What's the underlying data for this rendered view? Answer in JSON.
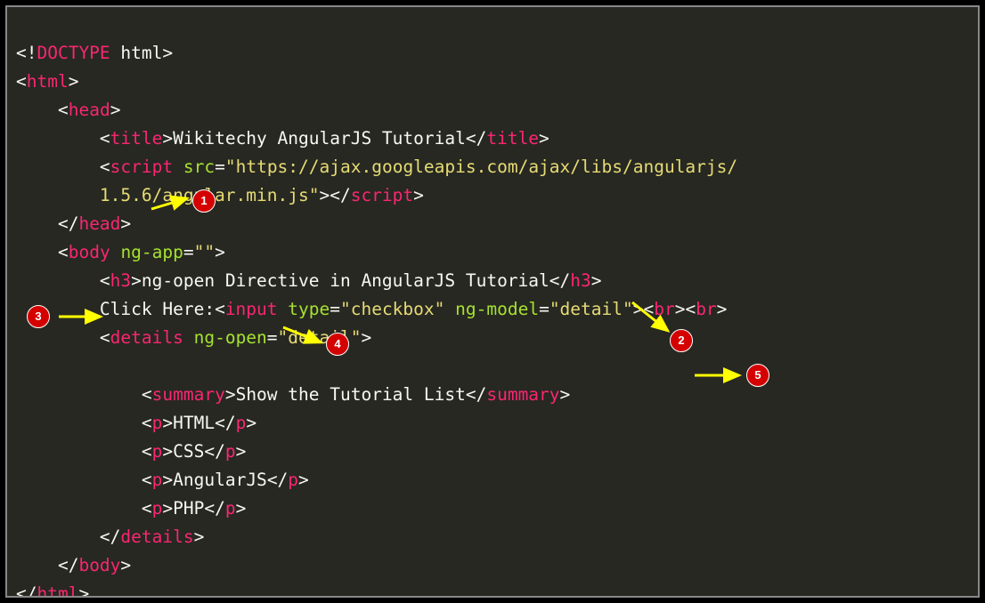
{
  "code": {
    "line1_doctype_open": "<!",
    "line1_doctype_kw": "DOCTYPE",
    "line1_doctype_rest": " html",
    "line1_close": ">",
    "tag_html": "html",
    "tag_head": "head",
    "tag_title": "title",
    "title_text": "Wikitechy AngularJS Tutorial",
    "tag_script": "script",
    "attr_src": "src",
    "src_value1": "\"https://ajax.googleapis.com/ajax/libs/angularjs/",
    "src_value2": "1.5.6/angular.min.js\"",
    "tag_body": "body",
    "attr_ngapp": "ng-app",
    "ngapp_value": "\"\"",
    "tag_h3": "h3",
    "h3_text": "ng-open Directive in AngularJS Tutorial",
    "click_here_text": "Click Here:",
    "tag_input": "input",
    "attr_type": "type",
    "type_value": "\"checkbox\"",
    "attr_ngmodel": "ng-model",
    "ngmodel_value": "\"detail\"",
    "tag_br": "br",
    "tag_details": "details",
    "attr_ngopen": "ng-open",
    "ngopen_value": "\"detail\"",
    "tag_summary": "summary",
    "summary_text": "Show the Tutorial List",
    "tag_p": "p",
    "p1_text": "HTML",
    "p2_text": "CSS",
    "p3_text": "AngularJS",
    "p4_text": "PHP"
  },
  "badges": {
    "b1": "1",
    "b2": "2",
    "b3": "3",
    "b4": "4",
    "b5": "5"
  }
}
